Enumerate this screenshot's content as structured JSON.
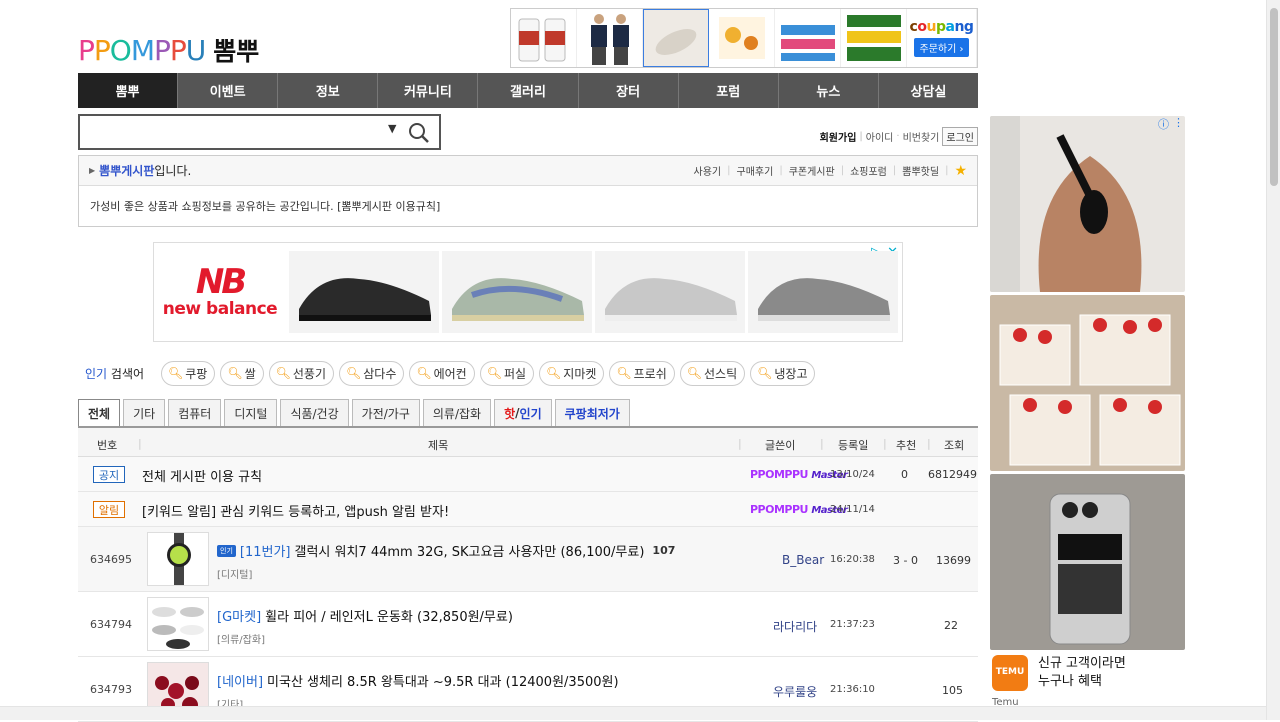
{
  "logo": {
    "mark": "PPOMPPU",
    "korean": "뽐뿌"
  },
  "top_banner": {
    "coupang": "coupang",
    "coupang_btn": "주문하기 ›"
  },
  "gnb": [
    "뽐뿌",
    "이벤트",
    "정보",
    "커뮤니티",
    "갤러리",
    "장터",
    "포럼",
    "뉴스",
    "상담실"
  ],
  "member": {
    "join": "회원가입",
    "id": "아이디",
    "pw": "비번찾기",
    "login": "로그인"
  },
  "board": {
    "name": "뽐뿌게시판",
    "suffix": " 입니다.",
    "links": [
      "사용기",
      "구매후기",
      "쿠폰게시판",
      "쇼핑포럼",
      "뽐뿌핫딜"
    ],
    "desc": "가성비 좋은 상품과 쇼핑정보를 공유하는 공간입니다. [뽐뿌게시판 이용규칙]"
  },
  "ad": {
    "brand_logo": "NB",
    "brand_text": "new balance"
  },
  "popular": {
    "label_hot": "인기",
    "label_rest": " 검색어",
    "keywords": [
      "쿠팡",
      "쌀",
      "선풍기",
      "삼다수",
      "에어컨",
      "퍼실",
      "지마켓",
      "프로쉬",
      "선스틱",
      "냉장고"
    ]
  },
  "tabs": {
    "all": "전체",
    "etc": "기타",
    "computer": "컴퓨터",
    "digital": "디지털",
    "food": "식품/건강",
    "appliance": "가전/가구",
    "clothing": "의류/잡화",
    "hot_a": "핫",
    "hot_sep": "/",
    "hot_b": "인기",
    "coupang": "쿠팡최저가"
  },
  "list_head": {
    "num": "번호",
    "title": "제목",
    "author": "글쓴이",
    "date": "등록일",
    "rec": "추천",
    "views": "조회"
  },
  "notices": [
    {
      "badge": "공지",
      "title": "전체 게시판 이용 규칙",
      "author_logo": "PPOMPPU",
      "author_sub": "Master",
      "date": "13/10/24",
      "rec": "0",
      "views": "6812949"
    },
    {
      "badge": "알림",
      "title": "[키워드 알림] 관심 키워드 등록하고, 앱push 알림 받자!",
      "author_logo": "PPOMPPU",
      "author_sub": "Master",
      "date": "24/11/14"
    }
  ],
  "posts": [
    {
      "num": "634695",
      "hot": "인기",
      "shop": "[11번가]",
      "title": "갤럭시 워치7 44mm 32G, SK고요금 사용자만 (86,100/무료)",
      "comments": "107",
      "category": "[디지털]",
      "author": "B_Bear",
      "time": "16:20:38",
      "rec": "3 - 0",
      "views": "13699"
    },
    {
      "num": "634794",
      "shop": "[G마켓]",
      "title": "휠라 피어 / 레인저L 운동화 (32,850원/무료)",
      "category": "[의류/잡화]",
      "author": "라다리다",
      "time": "21:37:23",
      "views": "22"
    },
    {
      "num": "634793",
      "shop": "[네이버]",
      "title": "미국산 생체리 8.5R 왕특대과 ~9.5R 대과 (12400원/3500원)",
      "category": "[기타]",
      "author": "우루룰웅",
      "time": "21:36:10",
      "views": "105"
    }
  ],
  "side_ad": {
    "temu_logo": "TEMU",
    "line1": "신규 고객이라면",
    "line2": "누구나 혜택",
    "name": "Temu"
  },
  "colors": {
    "nav_bg": "#555555",
    "nav_active": "#222222",
    "link_blue": "#2266cc",
    "hot_red": "#e31919",
    "nb_red": "#e21a2c"
  }
}
